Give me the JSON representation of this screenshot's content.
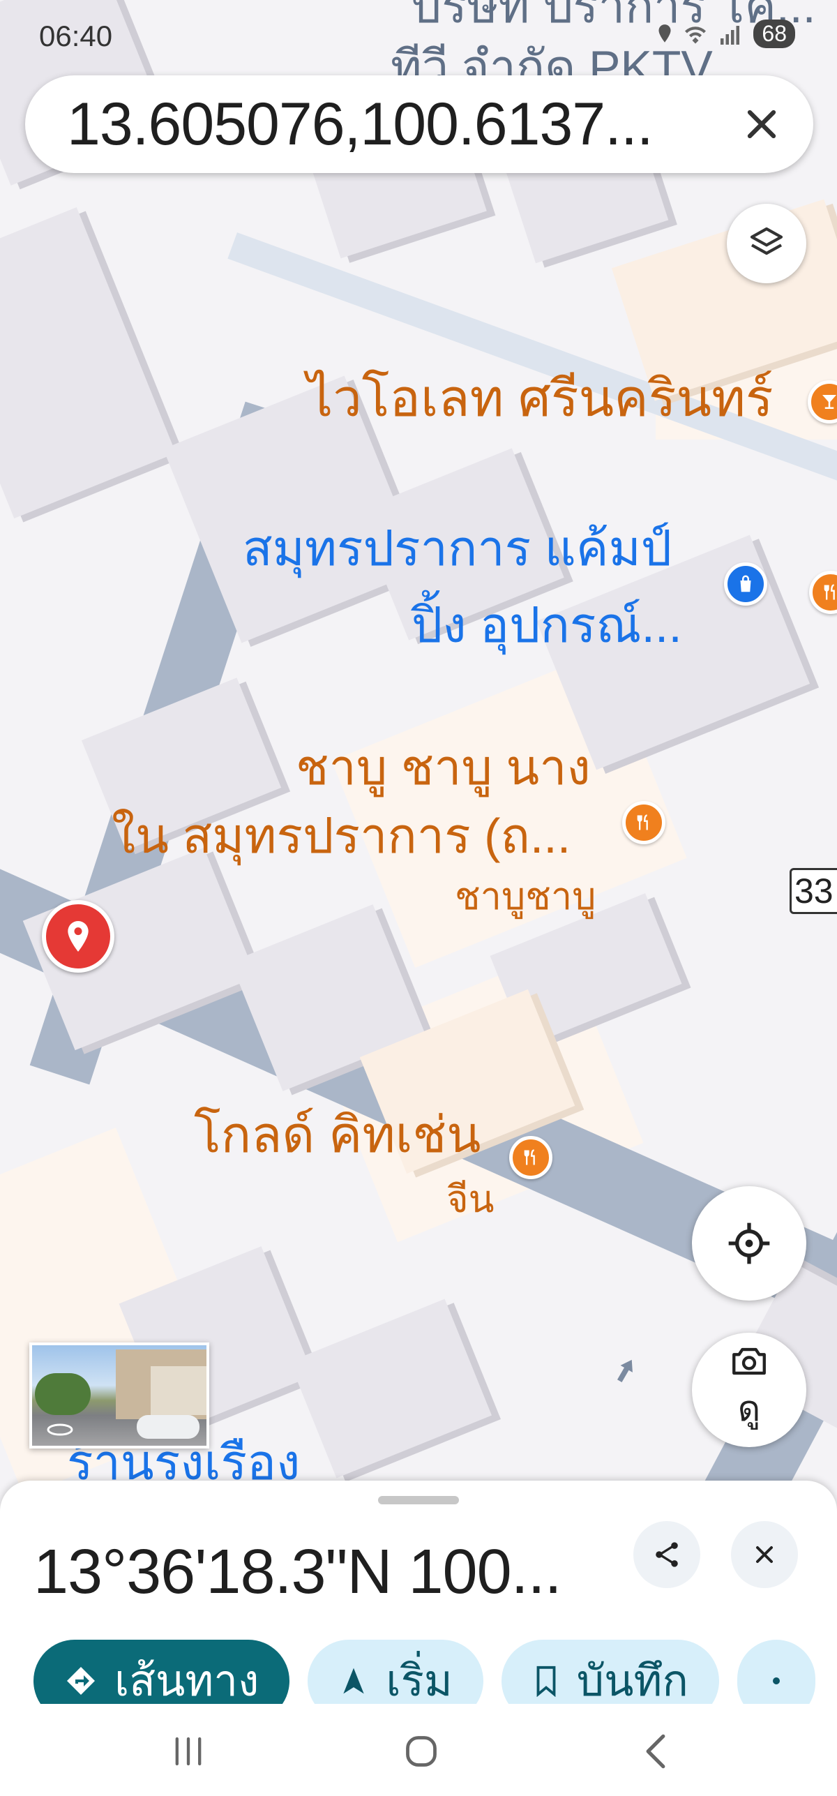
{
  "status_bar": {
    "time": "06:40",
    "battery": "68"
  },
  "search": {
    "query": "13.605076,100.6137..."
  },
  "map": {
    "top_label_1": "บริษัท ปราการ โค...",
    "top_label_2": "ทีวี จำกัด PKTV",
    "route_number": "33",
    "pois": {
      "violet": "ไวโอเลท ศรีนครินทร์",
      "camping_line1": "สมุทรปราการ แค้มป์",
      "camping_line2": "ปิ้ง อุปกรณ์...",
      "shabu_line1": "ชาบู ชาบู นาง",
      "shabu_line2": "ใน สมุทรปราการ (ถ...",
      "shabu_category": "ชาบูชาบู",
      "gold_kitchen": "โกลด์ คิทเช่น",
      "gold_category": "จีน",
      "bottom_store": "ร้านรุ่งเรือง"
    }
  },
  "controls": {
    "street_view_label": "ดู"
  },
  "bottom_sheet": {
    "title": "13°36'18.3\"N 100...",
    "chips": [
      {
        "label": "เส้นทาง",
        "icon": "directions-icon"
      },
      {
        "label": "เริ่ม",
        "icon": "navigation-arrow-icon"
      },
      {
        "label": "บันทึก",
        "icon": "bookmark-icon"
      }
    ]
  },
  "colors": {
    "poi_orange": "#c8640f",
    "poi_blue": "#1a73e8",
    "primary_chip": "#0b6b78",
    "pin_red": "#e53935"
  }
}
